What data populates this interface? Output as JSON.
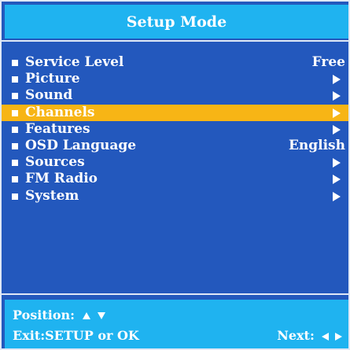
{
  "header": {
    "title": "Setup Mode"
  },
  "menu": {
    "items": [
      {
        "label": "Service Level",
        "value": "Free",
        "type": "value"
      },
      {
        "label": "Picture",
        "type": "submenu"
      },
      {
        "label": "Sound",
        "type": "submenu"
      },
      {
        "label": "Channels",
        "type": "submenu",
        "selected": true
      },
      {
        "label": "Features",
        "type": "submenu"
      },
      {
        "label": "OSD Language",
        "value": "English",
        "type": "value"
      },
      {
        "label": "Sources",
        "type": "submenu"
      },
      {
        "label": "FM Radio",
        "type": "submenu"
      },
      {
        "label": "System",
        "type": "submenu"
      }
    ]
  },
  "footer": {
    "position_label": "Position:",
    "exit_label": "Exit:SETUP or OK",
    "next_label": "Next:"
  },
  "colors": {
    "background": "#2358bd",
    "title_bar": "#1fb3f0",
    "selected_row": "#f7b515",
    "text": "#ffffff"
  }
}
